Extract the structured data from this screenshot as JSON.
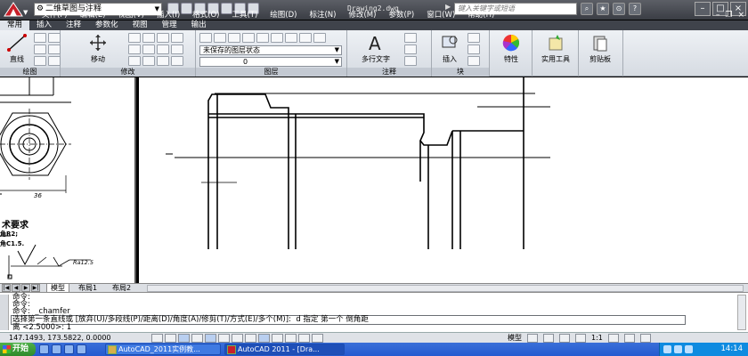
{
  "window": {
    "workspace": "二维草图与注释",
    "doc_title": "Drawing2.dwg",
    "search_placeholder": "键入关键字或短语"
  },
  "menu": [
    "文件(F)",
    "编辑(E)",
    "视图(V)",
    "插入(I)",
    "格式(O)",
    "工具(T)",
    "绘图(D)",
    "标注(N)",
    "修改(M)",
    "参数(P)",
    "窗口(W)",
    "帮助(H)"
  ],
  "ribbon_tabs": [
    "常用",
    "插入",
    "注释",
    "参数化",
    "视图",
    "管理",
    "输出"
  ],
  "ribbon": {
    "draw": {
      "title": "绘图",
      "line_label": "直线"
    },
    "modify": {
      "title": "修改",
      "move_label": "移动"
    },
    "layers": {
      "title": "图层",
      "layer_state": "未保存的图层状态",
      "current_layer": "0"
    },
    "annotation": {
      "title": "注释",
      "mtext_label": "多行文字"
    },
    "block": {
      "title": "块",
      "insert_label": "插入"
    },
    "properties": {
      "label": "特性"
    },
    "utilities": {
      "label": "实用工具"
    },
    "clipboard": {
      "label": "剪贴板"
    }
  },
  "left_pane": {
    "dim_value": "36",
    "heading": "术要求",
    "line1": "角R2;",
    "line2": "角C1.5.",
    "roughness": "Ra12.5"
  },
  "layout_tabs": [
    "模型",
    "布局1",
    "布局2"
  ],
  "command": {
    "history": [
      "命令:",
      "命令:",
      "命令:  _chamfer"
    ],
    "line4": "选择第一条直线或 [放弃(U)/多段线(P)/距离(D)/角度(A)/修剪(T)/方式(E)/多个(M)]:  d 指定 第一个 倒角距",
    "line5": "离 <2.5000>: 1"
  },
  "status": {
    "coords": "147.1493, 173.5822, 0.0000",
    "space": "模型",
    "scale": "1:1"
  },
  "taskbar": {
    "start": "开始",
    "tasks": [
      "AutoCAD_2011实例教...",
      "AutoCAD 2011 - [Dra..."
    ],
    "clock": "14:14"
  }
}
